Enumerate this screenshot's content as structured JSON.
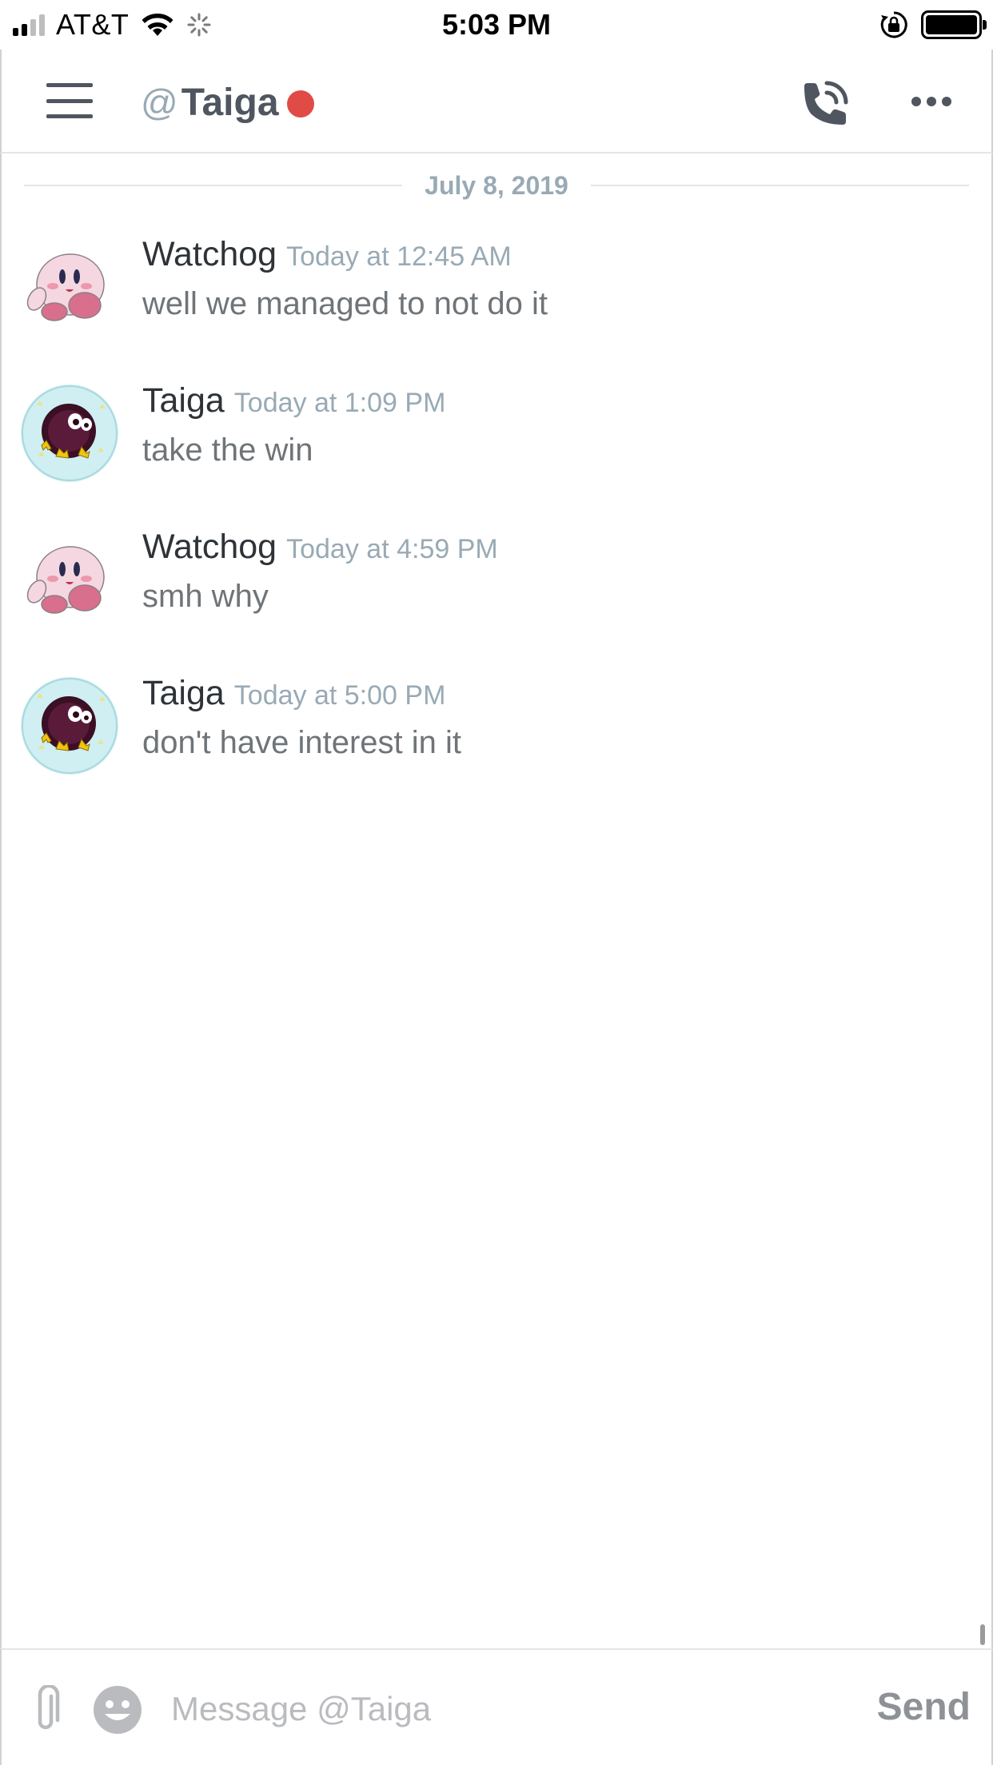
{
  "status_bar": {
    "carrier": "AT&T",
    "time": "5:03 PM",
    "icons": [
      "signal-icon",
      "wifi-icon",
      "activity-spinner-icon",
      "rotation-lock-icon",
      "battery-icon"
    ]
  },
  "header": {
    "at_symbol": "@",
    "channel_name": "Taiga",
    "status_color": "#e14b45",
    "icons": [
      "menu-icon",
      "phone-call-icon",
      "more-options-icon"
    ]
  },
  "chat": {
    "date_divider": "July 8, 2019",
    "messages": [
      {
        "author": "Watchog",
        "timestamp": "Today at 12:45 AM",
        "text": "well we managed to not do it",
        "avatar": "kirby-avatar"
      },
      {
        "author": "Taiga",
        "timestamp": "Today at 1:09 PM",
        "text": "take the win",
        "avatar": "kuriboh-avatar"
      },
      {
        "author": "Watchog",
        "timestamp": "Today at 4:59 PM",
        "text": "smh why",
        "avatar": "kirby-avatar"
      },
      {
        "author": "Taiga",
        "timestamp": "Today at 5:00 PM",
        "text": "don't have interest in it",
        "avatar": "kuriboh-avatar"
      }
    ]
  },
  "composer": {
    "placeholder": "Message @Taiga",
    "value": "",
    "send_label": "Send",
    "icons": [
      "paperclip-icon",
      "emoji-icon"
    ]
  },
  "colors": {
    "muted": "#99aab5",
    "text": "#2e3338",
    "message_text": "#6f7478",
    "status_dnd": "#e14b45"
  }
}
